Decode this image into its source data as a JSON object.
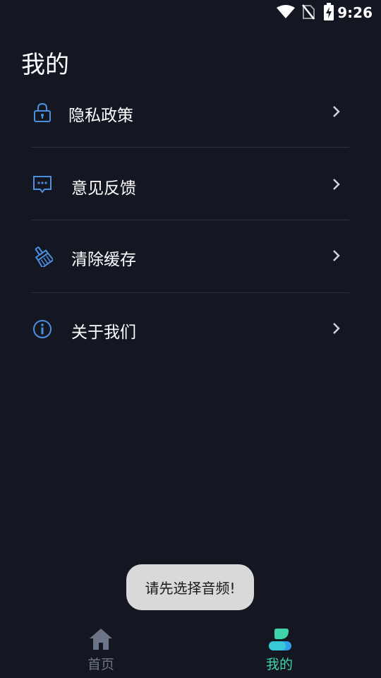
{
  "status_bar": {
    "time": "9:26",
    "icons": [
      "wifi-icon",
      "no-sim-icon",
      "battery-charging-icon"
    ]
  },
  "page": {
    "title": "我的"
  },
  "menu": {
    "items": [
      {
        "label": "隐私政策",
        "icon": "lock-icon"
      },
      {
        "label": "意见反馈",
        "icon": "message-dots-icon"
      },
      {
        "label": "清除缓存",
        "icon": "broom-icon"
      },
      {
        "label": "关于我们",
        "icon": "info-icon"
      }
    ]
  },
  "toast": {
    "text": "请先选择音频!"
  },
  "bottom_nav": {
    "tabs": [
      {
        "label": "首页",
        "icon": "home-icon",
        "active": false
      },
      {
        "label": "我的",
        "icon": "person-icon",
        "active": true
      }
    ]
  },
  "colors": {
    "background": "#141722",
    "accent": "#3fd4a8",
    "icon_blue": "#4a8fe0",
    "inactive": "#6c7488",
    "divider": "#2e3140"
  }
}
